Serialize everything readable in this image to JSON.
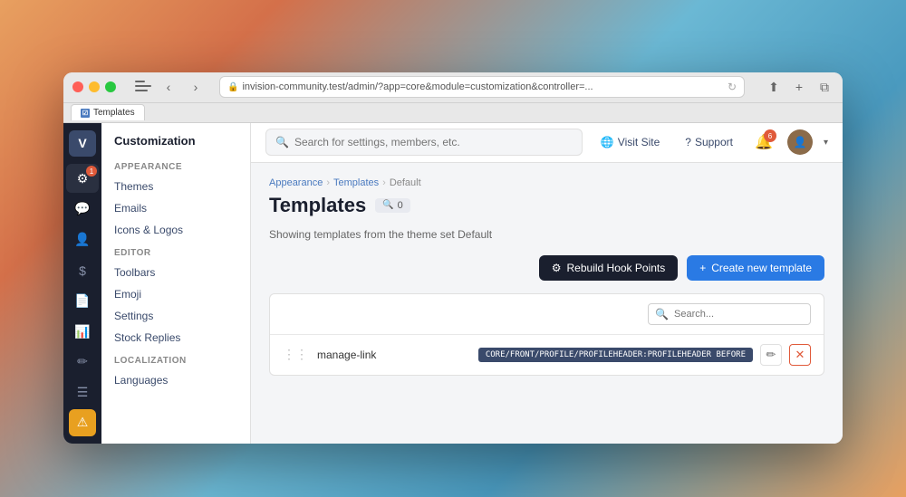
{
  "browser": {
    "url": "invision-community.test/admin/?app=core&module=customization&controller=...",
    "tab_label": "Templates",
    "tab_favicon": "☑"
  },
  "topbar": {
    "search_placeholder": "Search for settings, members, etc.",
    "visit_site_label": "Visit Site",
    "support_label": "Support",
    "notification_count": "6"
  },
  "icon_sidebar": {
    "logo_letter": "V",
    "badge_count": "1",
    "icons": [
      "gear",
      "chat",
      "user",
      "dollar",
      "file",
      "chart",
      "pen",
      "list"
    ]
  },
  "nav_sidebar": {
    "title": "Customization",
    "sections": [
      {
        "label": "APPEARANCE",
        "items": [
          "Themes",
          "Emails",
          "Icons & Logos"
        ]
      },
      {
        "label": "EDITOR",
        "items": [
          "Toolbars",
          "Emoji",
          "Settings",
          "Stock Replies"
        ]
      },
      {
        "label": "LOCALIZATION",
        "items": [
          "Languages"
        ]
      }
    ]
  },
  "breadcrumb": {
    "items": [
      "Appearance",
      "Templates",
      "Default"
    ]
  },
  "page": {
    "title": "Templates",
    "count_icon": "🔍",
    "count": "0",
    "showing_text": "Showing templates from the theme set Default"
  },
  "actions": {
    "rebuild_label": "Rebuild Hook Points",
    "create_label": "Create new template"
  },
  "template_list": {
    "search_placeholder": "Search...",
    "rows": [
      {
        "name": "manage-link",
        "key": "CORE/FRONT/PROFILE/PROFILEHEADER:PROFILEHEADER BEFORE",
        "edit_icon": "✏",
        "delete_icon": "✕"
      }
    ]
  }
}
